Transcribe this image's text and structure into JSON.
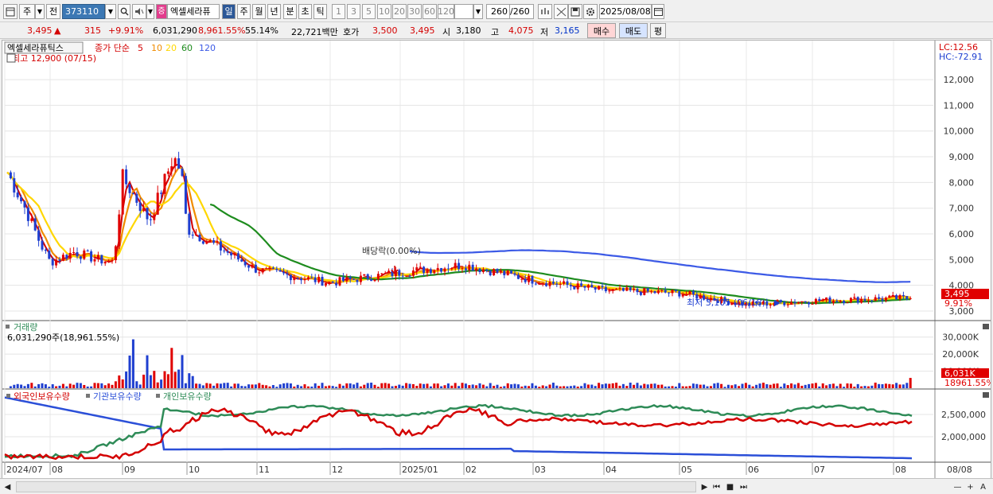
{
  "toolbar": {
    "period_type": "주",
    "period_prev": "전",
    "stock_code": "373110",
    "stock_name": "엑셀세라퓨",
    "name_badge": "증",
    "intervals": [
      "일",
      "주",
      "월",
      "년",
      "분",
      "초",
      "틱"
    ],
    "active_interval": "일",
    "ranges": [
      "1",
      "3",
      "5",
      "10",
      "20",
      "30",
      "60",
      "120"
    ],
    "count": "260",
    "count_total": "/260",
    "date": "2025/08/08"
  },
  "quote": {
    "price": "3,495",
    "change_arrow": "▲",
    "change": "315",
    "change_pct": "+9.91%",
    "volume": "6,031,290",
    "volume_pct": "8,961.55%",
    "turnover_pct": "55.14%",
    "amount": "22,721백만",
    "ask_label": "호가",
    "ask1": "3,500",
    "ask2": "3,495",
    "open_label": "시",
    "open": "3,180",
    "high_label": "고",
    "high": "4,075",
    "low_label": "저",
    "low": "3,165",
    "buy_label": "매수",
    "sell_label": "매도",
    "eval_label": "평"
  },
  "price_panel": {
    "name_tag": "엑셀세라퓨틱스",
    "ma_label": "종가 단순",
    "ma_periods": [
      "5",
      "10",
      "20",
      "60",
      "120"
    ],
    "ma_colors": [
      "#d40000",
      "#f08c00",
      "#ffd700",
      "#1e8c1e",
      "#3c5ae6"
    ],
    "high_note": "최고 12,900 (07/15)",
    "low_note": "최저 3,105 (06/18)",
    "dividend_note": "배당락(0.00%)",
    "lc_label": "LC:12.56",
    "hc_label": "HC:-72.91",
    "y_ticks": [
      "12,000",
      "11,000",
      "10,000",
      "9,000",
      "8,000",
      "7,000",
      "6,000",
      "5,000",
      "4,000",
      "3,000"
    ],
    "price_tag": "3,495",
    "pct_tag": "9.91%"
  },
  "volume_panel": {
    "title": "거래량",
    "subtitle": "6,031,290주(18,961.55%)",
    "y_ticks": [
      "30,000K",
      "20,000K",
      "10,000K"
    ],
    "value_tag": "6,031K",
    "pct_tag": "18961.55%"
  },
  "holder_panel": {
    "legend": [
      "외국인보유수량",
      "기관보유수량",
      "개인보유수량"
    ],
    "legend_colors": [
      "#d40000",
      "#2b4fd8",
      "#2e8b57"
    ],
    "y_ticks": [
      "2,500,000",
      "2,000,000"
    ]
  },
  "x_axis": {
    "labels": [
      "2024/07",
      "08",
      "09",
      "10",
      "11",
      "12",
      "2025/01",
      "02",
      "03",
      "04",
      "05",
      "06",
      "07",
      "08"
    ],
    "end_label": "08/08"
  },
  "chart_data": [
    {
      "type": "candlestick",
      "title": "엑셀세라퓨틱스",
      "ylabel": "",
      "ylim": [
        3000,
        12900
      ],
      "series_names": [
        "5",
        "10",
        "20",
        "60",
        "120"
      ],
      "close_by_month": [
        {
          "month": "2024/07",
          "value": 8300
        },
        {
          "month": "2024/08",
          "value": 4900
        },
        {
          "month": "2024/09",
          "value": 8200
        },
        {
          "month": "2024/10",
          "value": 6200
        },
        {
          "month": "2024/11",
          "value": 4600
        },
        {
          "month": "2024/12",
          "value": 4100
        },
        {
          "month": "2025/01",
          "value": 4500
        },
        {
          "month": "2025/02",
          "value": 4800
        },
        {
          "month": "2025/03",
          "value": 4200
        },
        {
          "month": "2025/04",
          "value": 3800
        },
        {
          "month": "2025/05",
          "value": 3700
        },
        {
          "month": "2025/06",
          "value": 3250
        },
        {
          "month": "2025/07",
          "value": 3400
        },
        {
          "month": "2025/08",
          "value": 3495
        }
      ],
      "max": {
        "value": 12900,
        "date": "07/15"
      },
      "min": {
        "value": 3105,
        "date": "06/18"
      }
    },
    {
      "type": "bar",
      "title": "거래량",
      "ylim": [
        0,
        35000
      ],
      "unit": "K",
      "last_value": 6031
    },
    {
      "type": "line",
      "title": "보유수량",
      "series": [
        {
          "name": "외국인보유수량"
        },
        {
          "name": "기관보유수량"
        },
        {
          "name": "개인보유수량"
        }
      ]
    }
  ],
  "statusbar": {
    "icons": [
      "first-icon",
      "prev-icon",
      "stop-icon",
      "next-icon",
      "zoom-icons"
    ]
  }
}
